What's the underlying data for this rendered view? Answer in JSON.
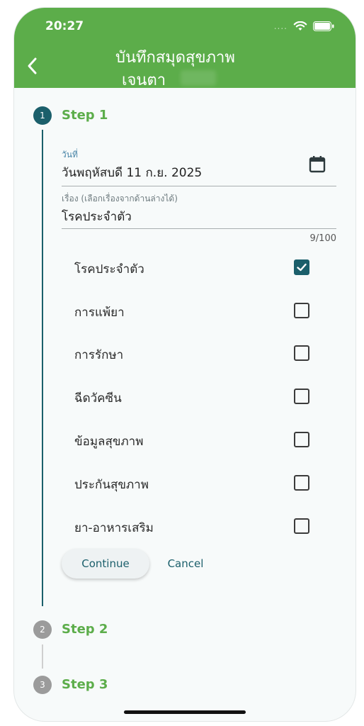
{
  "status_bar": {
    "time": "20:27",
    "dots": "...."
  },
  "header": {
    "title_line1": "บันทึกสมุดสุขภาพ",
    "title_line2": "เจนตา"
  },
  "colors": {
    "primary": "#5cad4a",
    "accent": "#1b5f6b",
    "inactive": "#9b9b9b"
  },
  "steps": [
    {
      "number": "1",
      "label": "Step 1"
    },
    {
      "number": "2",
      "label": "Step 2"
    },
    {
      "number": "3",
      "label": "Step 3"
    }
  ],
  "form": {
    "date_label": "วันที่",
    "date_value": "วันพฤหัสบดี 11 ก.ย. 2025",
    "subject_label": "เรื่อง (เลือกเรื่องจากด้านล่างได้)",
    "subject_value": "โรคประจำตัว",
    "counter": "9/100"
  },
  "options": [
    {
      "label": "โรคประจำตัว",
      "checked": true
    },
    {
      "label": "การแพ้ยา",
      "checked": false
    },
    {
      "label": "การรักษา",
      "checked": false
    },
    {
      "label": "ฉีดวัคซีน",
      "checked": false
    },
    {
      "label": "ข้อมูลสุขภาพ",
      "checked": false
    },
    {
      "label": "ประกันสุขภาพ",
      "checked": false
    },
    {
      "label": "ยา-อาหารเสริม",
      "checked": false
    }
  ],
  "buttons": {
    "continue": "Continue",
    "cancel": "Cancel"
  },
  "icons": {
    "back": "chevron-left-icon",
    "calendar": "calendar-icon",
    "wifi": "wifi-icon",
    "battery": "battery-icon"
  }
}
